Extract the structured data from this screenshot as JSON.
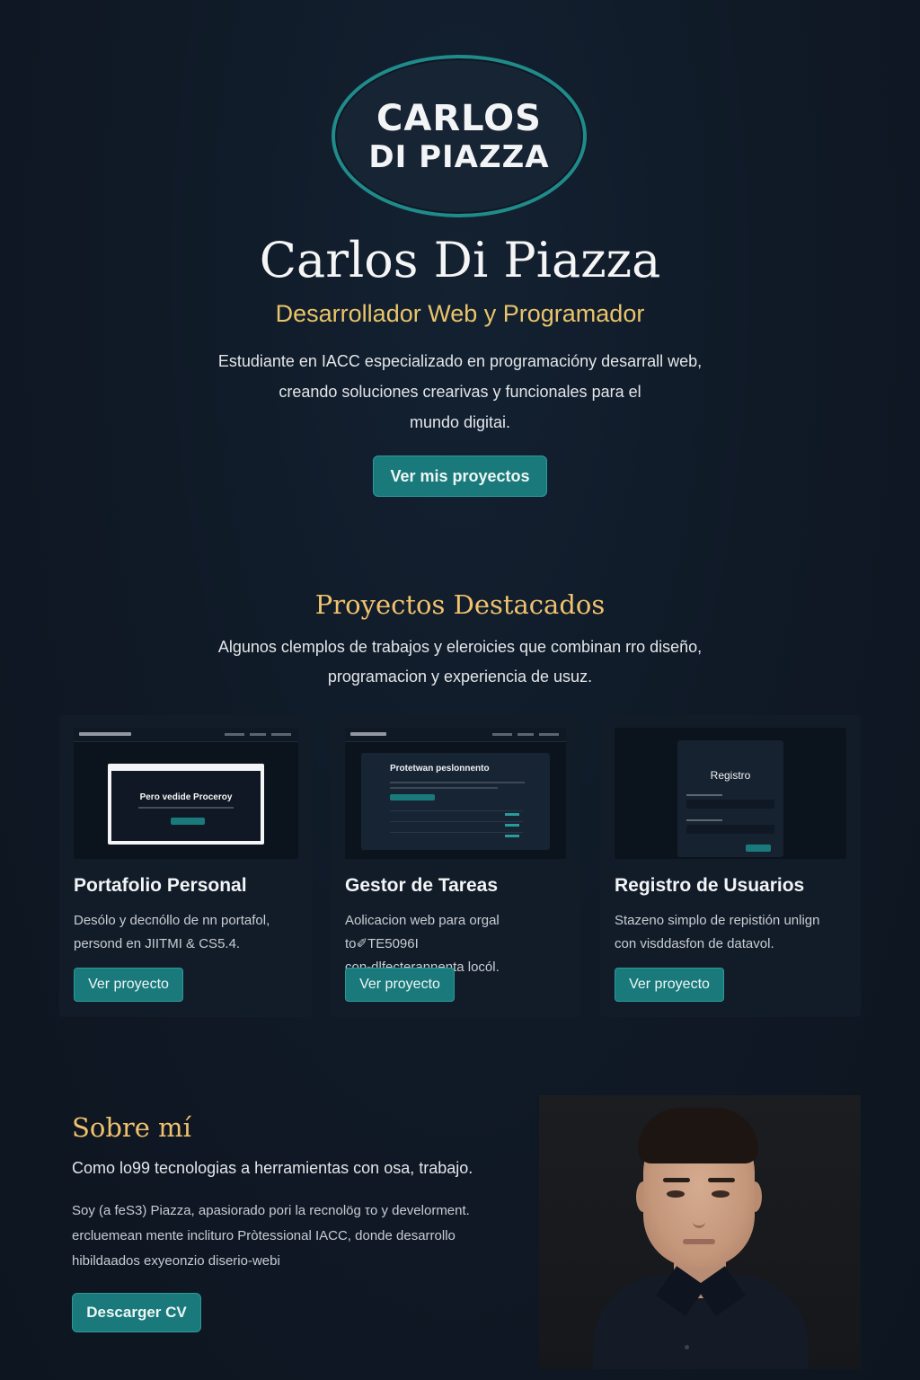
{
  "hero": {
    "logo_line1": "CARLOS",
    "logo_line2": "DI PIAZZA",
    "name": "Carlos Di Piazza",
    "subtitle": "Desarrollador Web y Programador",
    "description_line1": "Estudiante en IACC especializado en programacióny desarrall web,",
    "description_line2": "creando soluciones crearivas y funcionales para el",
    "description_line3": "mundo digitai.",
    "cta_label": "Ver mis proyectos"
  },
  "projects": {
    "title": "Proyectos Destacados",
    "description_line1": "Algunos clemplos de trabajos y eleroicies que combinan rro diseño,",
    "description_line2": "programacion y experiencia de usuz.",
    "items": [
      {
        "name": "Portafolio Personal",
        "desc_line1": "Desólo y decпóllo de nn portafol,",
        "desc_line2": "persond en JIITMI & CS5.4.",
        "button_label": "Ver proyecto",
        "thumb_text": "Pero vedide Proceroy"
      },
      {
        "name": "Gestor de Tareas",
        "desc_line1": "Aolicacion web para orgal to✐TE5096I",
        "desc_line2": "con-dlfecterannenta locól.",
        "button_label": "Ver proyecto",
        "thumb_text": "Protetwan peslonnento"
      },
      {
        "name": "Registro de Usuarios",
        "desc_line1": "Stazeno simplo de repistión unlign",
        "desc_line2": "con visddasfon de datavol.",
        "button_label": "Ver proyecto",
        "thumb_text": "Registro"
      }
    ]
  },
  "about": {
    "title": "Sobre mí",
    "lead": "Como lo99 tecnologias a herramientas con osa, trabajo.",
    "body_line1": "Soy (a feS3) Piazza, apasiorado pori la recnolög τo y develorment.",
    "body_line2": "ercluemean mente inclituro Pròtessional IACC, donde desarrollo",
    "body_line3": "hibildaados exyeonzio diserio-webi",
    "cta_label": "Descarger CV"
  },
  "colors": {
    "background": "#0f1824",
    "accent": "#1a7a7b",
    "heading_gold": "#f0c26e",
    "subtitle_gold": "#e9c46a"
  }
}
